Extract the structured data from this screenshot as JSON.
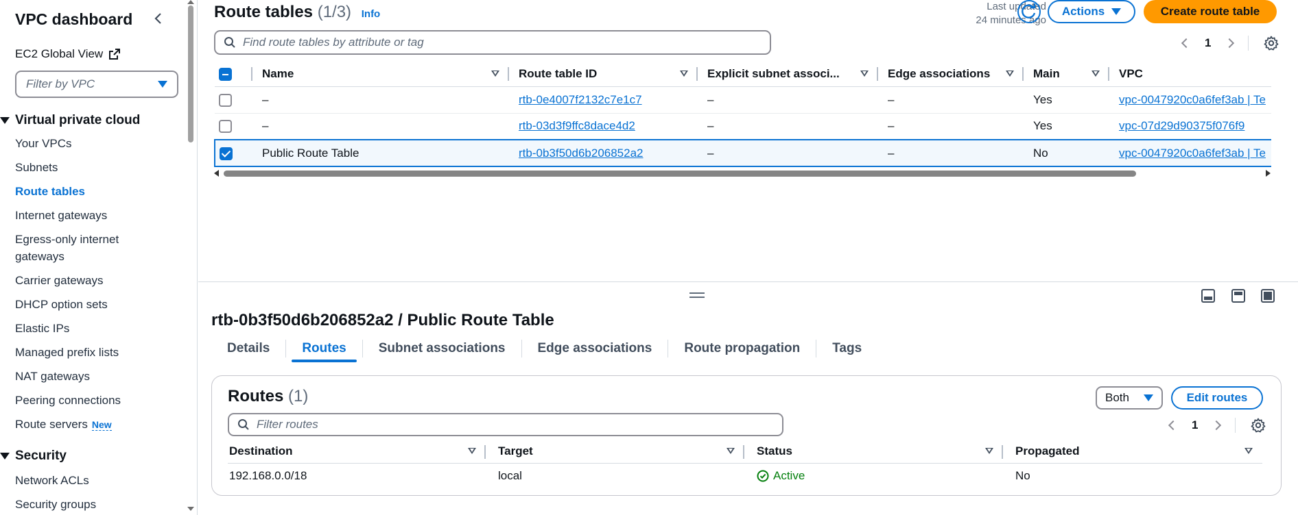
{
  "sidebar": {
    "title": "VPC dashboard",
    "global_view": "EC2 Global View",
    "filter_placeholder": "Filter by VPC",
    "section_vpc": "Virtual private cloud",
    "items": [
      {
        "label": "Your VPCs"
      },
      {
        "label": "Subnets"
      },
      {
        "label": "Route tables"
      },
      {
        "label": "Internet gateways"
      },
      {
        "label": "Egress-only internet gateways"
      },
      {
        "label": "Carrier gateways"
      },
      {
        "label": "DHCP option sets"
      },
      {
        "label": "Elastic IPs"
      },
      {
        "label": "Managed prefix lists"
      },
      {
        "label": "NAT gateways"
      },
      {
        "label": "Peering connections"
      },
      {
        "label": "Route servers"
      }
    ],
    "new_badge": "New",
    "section_security": "Security",
    "security_items": [
      {
        "label": "Network ACLs"
      },
      {
        "label": "Security groups"
      }
    ]
  },
  "header": {
    "title": "Route tables",
    "count": "(1/3)",
    "info": "Info",
    "last_updated_label": "Last updated",
    "last_updated_value": "24 minutes ago",
    "actions": "Actions",
    "create": "Create route table",
    "search_placeholder": "Find route tables by attribute or tag",
    "page": "1"
  },
  "table": {
    "columns": [
      "Name",
      "Route table ID",
      "Explicit subnet associ...",
      "Edge associations",
      "Main",
      "VPC"
    ],
    "rows": [
      {
        "name": "–",
        "id": "rtb-0e4007f2132c7e1c7",
        "explicit": "–",
        "edge": "–",
        "main": "Yes",
        "vpc": "vpc-0047920c0a6fef3ab | Te"
      },
      {
        "name": "–",
        "id": "rtb-03d3f9ffc8dace4d2",
        "explicit": "–",
        "edge": "–",
        "main": "Yes",
        "vpc": "vpc-07d29d90375f076f9"
      },
      {
        "name": "Public Route Table",
        "id": "rtb-0b3f50d6b206852a2",
        "explicit": "–",
        "edge": "–",
        "main": "No",
        "vpc": "vpc-0047920c0a6fef3ab | Te"
      }
    ]
  },
  "detail": {
    "title": "rtb-0b3f50d6b206852a2 / Public Route Table",
    "tabs": [
      "Details",
      "Routes",
      "Subnet associations",
      "Edge associations",
      "Route propagation",
      "Tags"
    ],
    "routes_title": "Routes",
    "routes_count": "(1)",
    "filter_select": "Both",
    "edit_routes": "Edit routes",
    "filter_placeholder": "Filter routes",
    "page": "1",
    "columns": [
      "Destination",
      "Target",
      "Status",
      "Propagated"
    ],
    "rows": [
      {
        "destination": "192.168.0.0/18",
        "target": "local",
        "status": "Active",
        "propagated": "No"
      }
    ]
  },
  "colors": {
    "accent": "#0972d3",
    "primary_button": "#ff9900",
    "success": "#037f0c"
  }
}
